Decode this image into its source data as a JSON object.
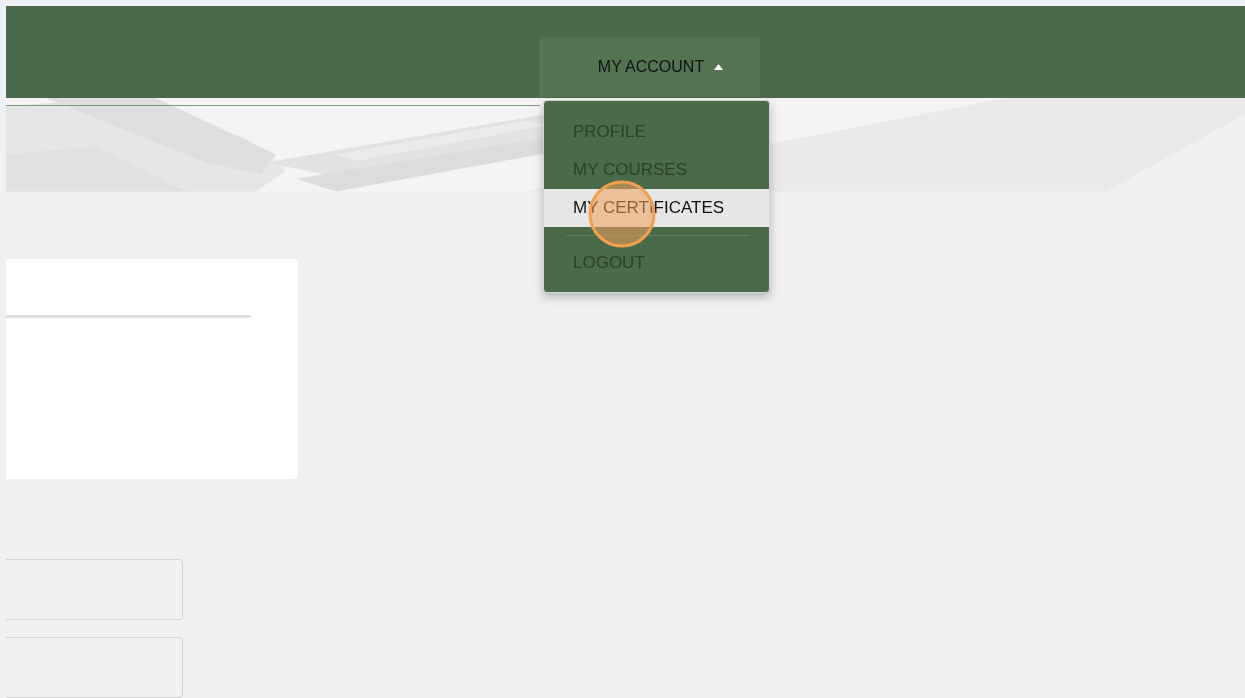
{
  "account_menu": {
    "label": "MY ACCOUNT",
    "expanded": true,
    "items": [
      {
        "label": "PROFILE",
        "selected": false,
        "kind": "item"
      },
      {
        "label": "MY COURSES",
        "selected": false,
        "kind": "item"
      },
      {
        "label": "MY CERTIFICATES",
        "selected": true,
        "kind": "item"
      },
      {
        "label": "LOGOUT",
        "selected": false,
        "kind": "after-divider"
      }
    ]
  }
}
